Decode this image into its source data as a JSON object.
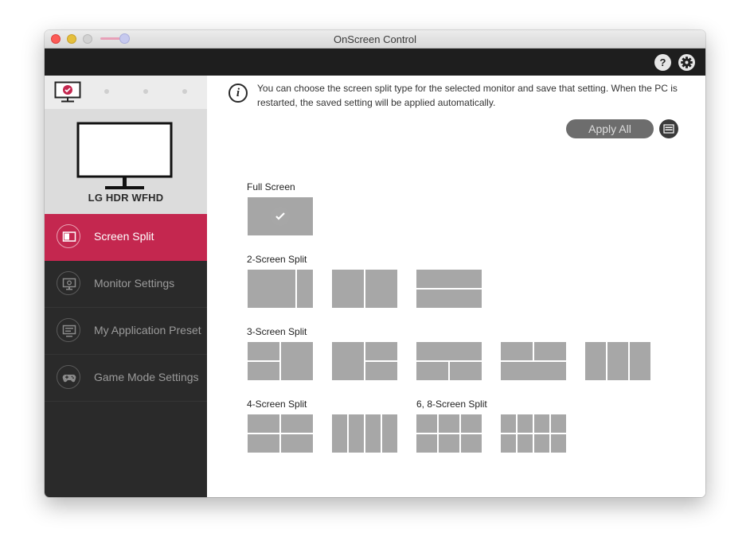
{
  "window": {
    "title": "OnScreen Control"
  },
  "toolbar": {
    "help_label": "?",
    "settings_icon": "gear-icon"
  },
  "monitor": {
    "name": "LG HDR WFHD"
  },
  "sidebar": {
    "items": [
      {
        "label": "Screen Split",
        "icon": "screen-split-icon",
        "active": true
      },
      {
        "label": "Monitor Settings",
        "icon": "monitor-settings-icon",
        "active": false
      },
      {
        "label": "My Application Preset",
        "icon": "app-preset-icon",
        "active": false
      },
      {
        "label": "Game Mode Settings",
        "icon": "gamepad-icon",
        "active": false
      }
    ]
  },
  "content": {
    "info_icon_glyph": "i",
    "info_text": "You can choose the screen split type for the selected monitor and save that setting. When the PC is restarted, the saved setting will be applied automatically.",
    "apply_all_label": "Apply All",
    "sections": {
      "full": "Full Screen",
      "two": "2-Screen Split",
      "three": "3-Screen Split",
      "four": "4-Screen Split",
      "six_eight": "6, 8-Screen Split"
    },
    "selected_layout": "full-screen"
  },
  "colors": {
    "accent": "#c4274f",
    "sidebar_bg": "#2a2a2a",
    "topbar_bg": "#1e1e1e",
    "tile": "#a7a7a7"
  }
}
